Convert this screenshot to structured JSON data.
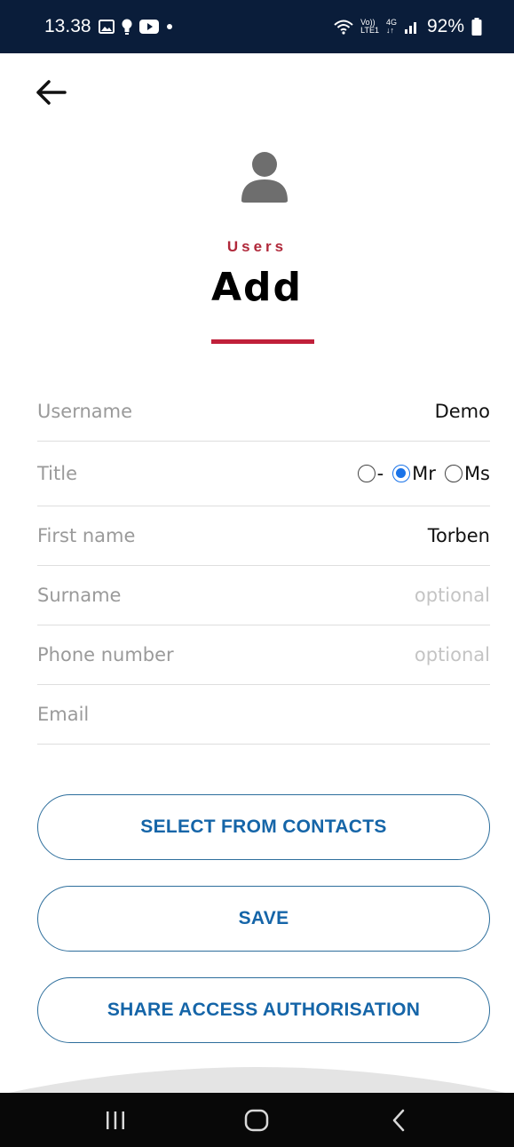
{
  "status_bar": {
    "time": "13.38",
    "icons_left": [
      "gallery-icon",
      "bulb-icon",
      "youtube-icon",
      "dot-icon"
    ],
    "network_volte": "Vo))",
    "network_lte": "LTE1",
    "network_gen": "4G",
    "battery": "92%"
  },
  "header": {
    "section": "Users",
    "title": "Add"
  },
  "form": {
    "username_label": "Username",
    "username_value": "Demo",
    "title_label": "Title",
    "title_options": [
      "-",
      "Mr",
      "Ms"
    ],
    "title_selected": "Mr",
    "first_name_label": "First name",
    "first_name_value": "Torben",
    "surname_label": "Surname",
    "surname_placeholder": "optional",
    "phone_label": "Phone number",
    "phone_placeholder": "optional",
    "email_label": "Email",
    "email_value": ""
  },
  "buttons": {
    "select_contacts": "SELECT FROM CONTACTS",
    "save": "SAVE",
    "share": "SHARE ACCESS AUTHORISATION"
  },
  "colors": {
    "accent_red": "#c0203a",
    "button_blue": "#1565a8",
    "radio_blue": "#1a73e8",
    "status_bar": "#0a1d3a"
  }
}
